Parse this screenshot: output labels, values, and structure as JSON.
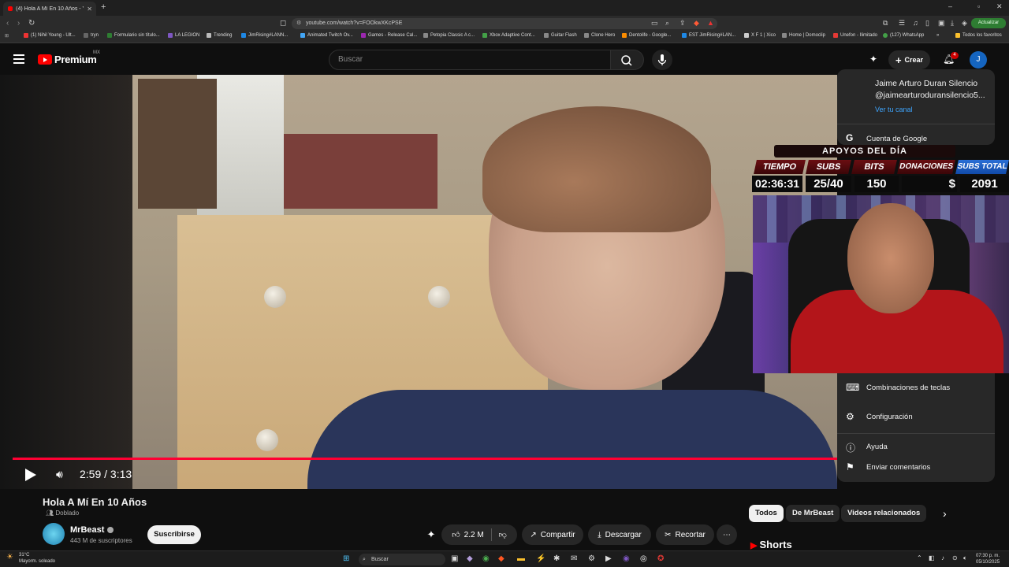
{
  "browser": {
    "tab_title": "(4) Hola A Mí En 10 Años - YouTube",
    "tab_close": "✕",
    "new_tab": "+",
    "url": "youtube.com/watch?v=FOOkwXKcPSE",
    "update_label": "Actualizar",
    "bookmarks": [
      "(1) Nihil Young - Ult...",
      "tryn",
      "Formulario sin título...",
      "LA LEGION",
      "Trending",
      "JimRising#LANN...",
      "Animated Twitch Ov...",
      "Games - Release Cal...",
      "Petopia Classic A c...",
      "Xbox Adaptive Cont...",
      "Guitar Flash",
      "Clone Hero",
      "Dentolife - Google...",
      "EST JimRising#LAN...",
      "X F 1 | Xico",
      "Home | Domoclip",
      "Unefon - Ilimitado",
      "(127) WhatsApp",
      "»",
      "Todos los favoritos"
    ]
  },
  "youtube": {
    "logo_text": "Premium",
    "region": "MX",
    "search_placeholder": "Buscar",
    "create_label": "Crear",
    "notification_count": "4",
    "avatar_letter": "J"
  },
  "video": {
    "current_time": "2:59",
    "duration": "3:13",
    "time_display": "2:59 / 3:13",
    "progress": 0.95
  },
  "stream_overlay": {
    "header": "APOYOS DEL DÍA",
    "labels": [
      "TIEMPO",
      "SUBS",
      "BITS",
      "DONACIONES",
      "SUBS TOTAL"
    ],
    "values": [
      "02:36:31",
      "25/40",
      "150",
      "$",
      "2091"
    ]
  },
  "account_menu": {
    "name": "Jaime Arturo Duran Silencio",
    "handle": "@jaimearturoduransilencio5...",
    "channel_link": "Ver tu canal",
    "google_account": "Cuenta de Google",
    "items": [
      "Combinaciones de teclas",
      "Configuración",
      "Ayuda",
      "Enviar comentarios"
    ]
  },
  "video_info": {
    "title": "Hola A Mí En 10 Años",
    "dubbed": "Doblado",
    "channel": "MrBeast",
    "subscribers": "443 M de suscriptores",
    "subscribe": "Suscribirse",
    "likes": "2.2 M",
    "share": "Compartir",
    "download": "Descargar",
    "clip": "Recortar",
    "more": "⋯"
  },
  "related": {
    "chips": [
      "Todos",
      "De MrBeast",
      "Videos relacionados"
    ],
    "shorts": "Shorts"
  },
  "taskbar": {
    "temperature": "31°C",
    "weather": "Mayorm. soleado",
    "search": "Buscar",
    "time": "07:30 p. m.",
    "date": "05/10/2025"
  },
  "colors": {
    "youtube_red": "#ff0000",
    "progress_red": "#ff0033",
    "background": "#0f0f0f",
    "overlay_label": "#6b0e12",
    "overlay_total": "#2a6fd6"
  }
}
